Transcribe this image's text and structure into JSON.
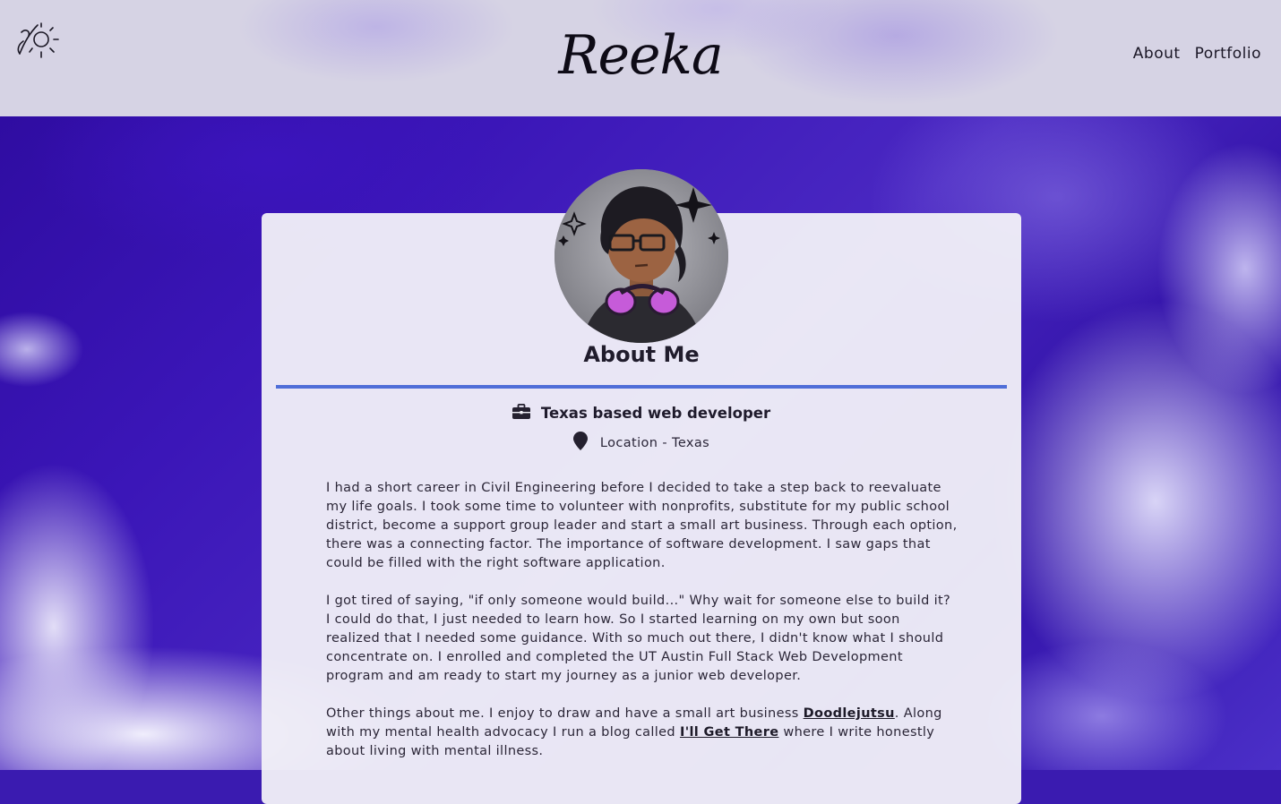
{
  "header": {
    "brand": "Reeka",
    "logo_icon": "paintbrush-sun-logo-icon",
    "nav": [
      {
        "label": "About"
      },
      {
        "label": "Portfolio"
      }
    ]
  },
  "profile": {
    "avatar_icon": "avatar-illustration",
    "title": "About Me",
    "role_icon": "briefcase-icon",
    "role": "Texas based web developer",
    "location_icon": "map-pin-icon",
    "location": "Location - Texas"
  },
  "bio": {
    "p1": "I had a short career in Civil Engineering before I decided to take a step back to reevaluate my life goals. I took some time to volunteer with nonprofits, substitute for my public school district, become a support group leader and start a small art business. Through each option, there was a connecting factor. The importance of software development. I saw gaps that could be filled with the right software application.",
    "p2": "I got tired of saying, \"if only someone would build...\" Why wait for someone else to build it? I could do that, I just needed to learn how. So I started learning on my own but soon realized that I needed some guidance. With so much out there, I didn't know what I should concentrate on. I enrolled and completed the UT Austin Full Stack Web Development program and am ready to start my journey as a junior web developer.",
    "p3_before": "Other things about me. I enjoy to draw and have a small art business ",
    "p3_link1": "Doodlejutsu",
    "p3_middle": ". Along with my mental health advocacy I run a blog called ",
    "p3_link2": "I'll Get There",
    "p3_after": " where I write honestly about living with mental illness."
  },
  "colors": {
    "accent_rule": "#4f6ed8",
    "background_purple": "#3b16b8",
    "header_bg": "#d6d3e4"
  }
}
